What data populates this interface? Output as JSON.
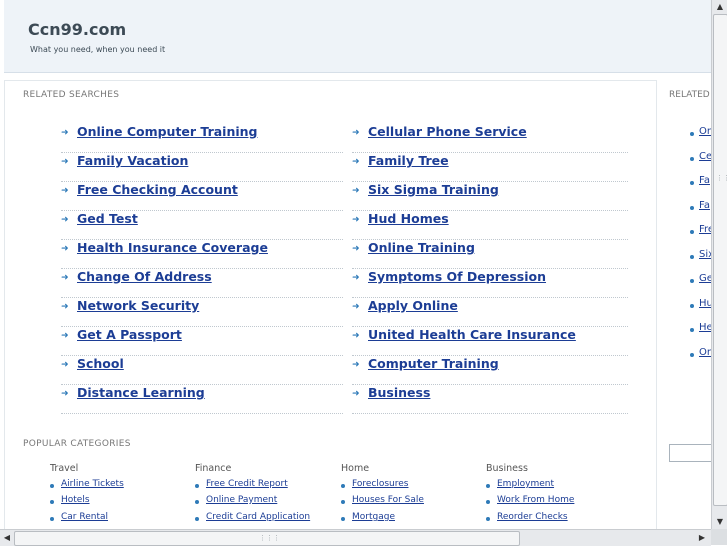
{
  "header": {
    "title": "Ccn99.com",
    "tagline": "What you need, when you need it"
  },
  "related": {
    "label": "RELATED SEARCHES",
    "left": [
      "Online Computer Training",
      "Family Vacation",
      "Free Checking Account",
      "Ged Test",
      "Health Insurance Coverage",
      "Change Of Address",
      "Network Security",
      "Get A Passport",
      "School",
      "Distance Learning"
    ],
    "right": [
      "Cellular Phone Service",
      "Family Tree",
      "Six Sigma Training",
      "Hud Homes",
      "Online Training",
      "Symptoms Of Depression",
      "Apply Online",
      "United Health Care Insurance",
      "Computer Training",
      "Business"
    ]
  },
  "popular": {
    "label": "POPULAR CATEGORIES",
    "columns": [
      {
        "heading": "Travel",
        "links": [
          "Airline Tickets",
          "Hotels",
          "Car Rental"
        ]
      },
      {
        "heading": "Finance",
        "links": [
          "Free Credit Report",
          "Online Payment",
          "Credit Card Application"
        ]
      },
      {
        "heading": "Home",
        "links": [
          "Foreclosures",
          "Houses For Sale",
          "Mortgage"
        ]
      },
      {
        "heading": "Business",
        "links": [
          "Employment",
          "Work From Home",
          "Reorder Checks"
        ]
      }
    ]
  },
  "side": {
    "label": "RELATED",
    "links": [
      "Or",
      "Ce",
      "Fa",
      "Fa",
      "Fre",
      "Six",
      "Ge",
      "Hu",
      "He",
      "Or"
    ]
  },
  "scrollbars": {
    "up": "▲",
    "down": "▼",
    "left": "◀",
    "right": "▶",
    "grip": "⋮⋮⋮"
  },
  "icons": {
    "arrow": "➜",
    "bullet": "bullet-dot"
  },
  "colors": {
    "link": "#1c3d95",
    "accent": "#2e7ab8",
    "header_bg": "#eef3f8"
  }
}
